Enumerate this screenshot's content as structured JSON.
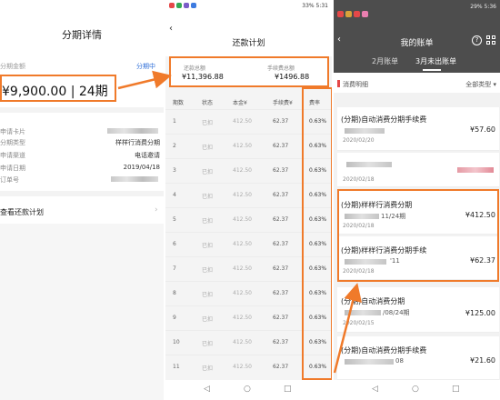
{
  "left": {
    "title": "分期详情",
    "amount_label": "分期金额",
    "status": "分期中",
    "amount": "¥9,900.00 | 24期",
    "details": [
      {
        "label": "申请卡片",
        "value": ""
      },
      {
        "label": "分期类型",
        "value": "样样行消费分期"
      },
      {
        "label": "申请渠道",
        "value": "电话邀请"
      },
      {
        "label": "申请日期",
        "value": "2019/04/18"
      },
      {
        "label": "订单号",
        "value": ""
      }
    ],
    "plan_link": "查看还款计划",
    "plan_chevron": "›"
  },
  "middle": {
    "status_time": "5:31",
    "status_battery": "33%",
    "back": "‹",
    "title": "还款计划",
    "summary": {
      "total_label": "还款总额",
      "total_value": "¥11,396.88",
      "fee_label": "手续费总额",
      "fee_value": "¥1496.88"
    },
    "headers": [
      "期数",
      "状态",
      "本金¥",
      "手续费¥",
      "费率"
    ],
    "rows": [
      [
        "1",
        "已扣",
        "412.50",
        "62.37",
        "0.63%"
      ],
      [
        "2",
        "已扣",
        "412.50",
        "62.37",
        "0.63%"
      ],
      [
        "3",
        "已扣",
        "412.50",
        "62.37",
        "0.63%"
      ],
      [
        "4",
        "已扣",
        "412.50",
        "62.37",
        "0.63%"
      ],
      [
        "5",
        "已扣",
        "412.50",
        "62.37",
        "0.63%"
      ],
      [
        "6",
        "已扣",
        "412.50",
        "62.37",
        "0.63%"
      ],
      [
        "7",
        "已扣",
        "412.50",
        "62.37",
        "0.63%"
      ],
      [
        "8",
        "已扣",
        "412.50",
        "62.37",
        "0.63%"
      ],
      [
        "9",
        "已扣",
        "412.50",
        "62.37",
        "0.63%"
      ],
      [
        "10",
        "已扣",
        "412.50",
        "62.37",
        "0.63%"
      ],
      [
        "11",
        "已扣",
        "412.50",
        "62.37",
        "0.63%"
      ]
    ],
    "nav": {
      "back": "◁",
      "home": "○",
      "recent": "□"
    }
  },
  "right": {
    "status_time": "5:36",
    "status_battery": "29%",
    "back": "‹",
    "title": "我的账单",
    "help": "?",
    "tabs": [
      "2月账单",
      "3月未出账单"
    ],
    "filter_left": "消费明细",
    "filter_right": "全部类型 ▾",
    "cards": [
      {
        "title": "(分期)自动消费分期手续费",
        "sub": "",
        "date": "2020/02/20",
        "amount": "¥57.60"
      },
      {
        "title": "",
        "sub": "",
        "date": "2020/02/18",
        "amount": ""
      },
      {
        "title": "(分期)样样行消费分期",
        "sub": "11/24期",
        "date": "2020/02/18",
        "amount": "¥412.50"
      },
      {
        "title": "(分期)样样行消费分期手续",
        "sub": "'11",
        "date": "2020/02/18",
        "amount": "¥62.37"
      },
      {
        "title": "(分期)自动消费分期",
        "sub": "/08/24期",
        "date": "2020/02/15",
        "amount": "¥125.00"
      },
      {
        "title": "(分期)自动消费分期手续费",
        "sub": "08",
        "date": "2020/02/15",
        "amount": "¥21.60"
      }
    ],
    "nav": {
      "back": "◁",
      "home": "○",
      "recent": "□"
    }
  },
  "colors": {
    "highlight": "#f07a2a",
    "link": "#2f6fd8",
    "dark_header": "#4d4d4d"
  }
}
